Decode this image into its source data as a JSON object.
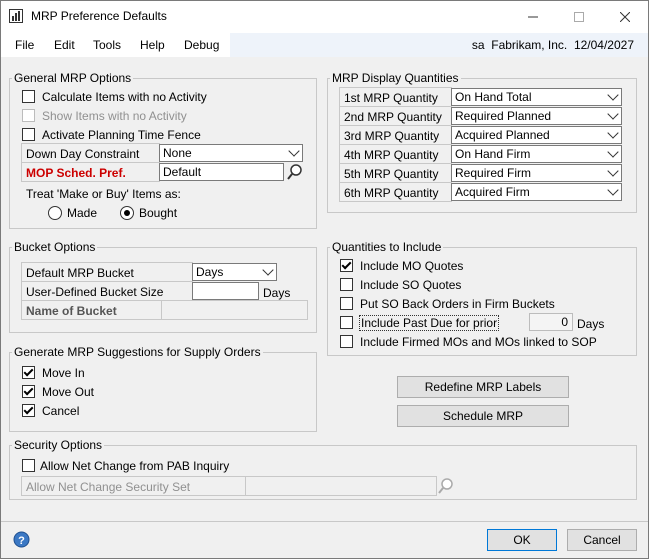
{
  "window": {
    "title": "MRP Preference Defaults"
  },
  "menu": {
    "file": "File",
    "edit": "Edit",
    "tools": "Tools",
    "help": "Help",
    "debug": "Debug"
  },
  "header": {
    "user": "sa",
    "company": "Fabrikam, Inc.",
    "date": "12/04/2027"
  },
  "general": {
    "legend": "General MRP Options",
    "calc_no_activity": {
      "label": "Calculate Items with no Activity",
      "checked": false
    },
    "show_no_activity": {
      "label": "Show Items with no Activity",
      "checked": false
    },
    "planning_fence": {
      "label": "Activate Planning Time Fence",
      "checked": false
    },
    "down_day_label": "Down Day Constraint",
    "down_day_value": "None",
    "mop_label": "MOP Sched. Pref.",
    "mop_value": "Default",
    "make_buy_label": "Treat 'Make or Buy' Items as:",
    "made_label": "Made",
    "bought_label": "Bought",
    "selected": "Bought"
  },
  "display": {
    "legend": "MRP Display Quantities",
    "rows": [
      {
        "label": "1st MRP Quantity",
        "value": "On Hand Total"
      },
      {
        "label": "2nd MRP Quantity",
        "value": "Required Planned"
      },
      {
        "label": "3rd MRP Quantity",
        "value": "Acquired Planned"
      },
      {
        "label": "4th MRP Quantity",
        "value": "On Hand Firm"
      },
      {
        "label": "5th MRP Quantity",
        "value": "Required Firm"
      },
      {
        "label": "6th MRP Quantity",
        "value": "Acquired Firm"
      }
    ]
  },
  "bucket": {
    "legend": "Bucket Options",
    "default_label": "Default MRP Bucket",
    "default_value": "Days",
    "size_label": "User-Defined Bucket Size",
    "size_value": "",
    "size_unit": "Days",
    "name_label": "Name of Bucket",
    "name_value": ""
  },
  "quantities": {
    "legend": "Quantities to Include",
    "mo_quotes": {
      "label": "Include MO Quotes",
      "checked": true
    },
    "so_quotes": {
      "label": "Include SO Quotes",
      "checked": false
    },
    "so_back": {
      "label": "Put SO Back Orders in Firm Buckets",
      "checked": false
    },
    "past_due": {
      "label": "Include Past Due for prior",
      "checked": false,
      "days": "0",
      "unit": "Days"
    },
    "firmed": {
      "label": "Include Firmed MOs and MOs linked to SOP",
      "checked": false
    }
  },
  "suggestions": {
    "legend": "Generate MRP Suggestions for Supply Orders",
    "move_in": {
      "label": "Move In",
      "checked": true
    },
    "move_out": {
      "label": "Move Out",
      "checked": true
    },
    "cancel": {
      "label": "Cancel",
      "checked": true
    }
  },
  "buttons": {
    "redefine": "Redefine MRP Labels",
    "schedule": "Schedule MRP",
    "ok": "OK",
    "cancel": "Cancel"
  },
  "security": {
    "legend": "Security Options",
    "allow_net_change": {
      "label": "Allow Net Change from PAB Inquiry",
      "checked": false
    },
    "security_set_label": "Allow Net Change Security Set",
    "security_set_value": ""
  }
}
